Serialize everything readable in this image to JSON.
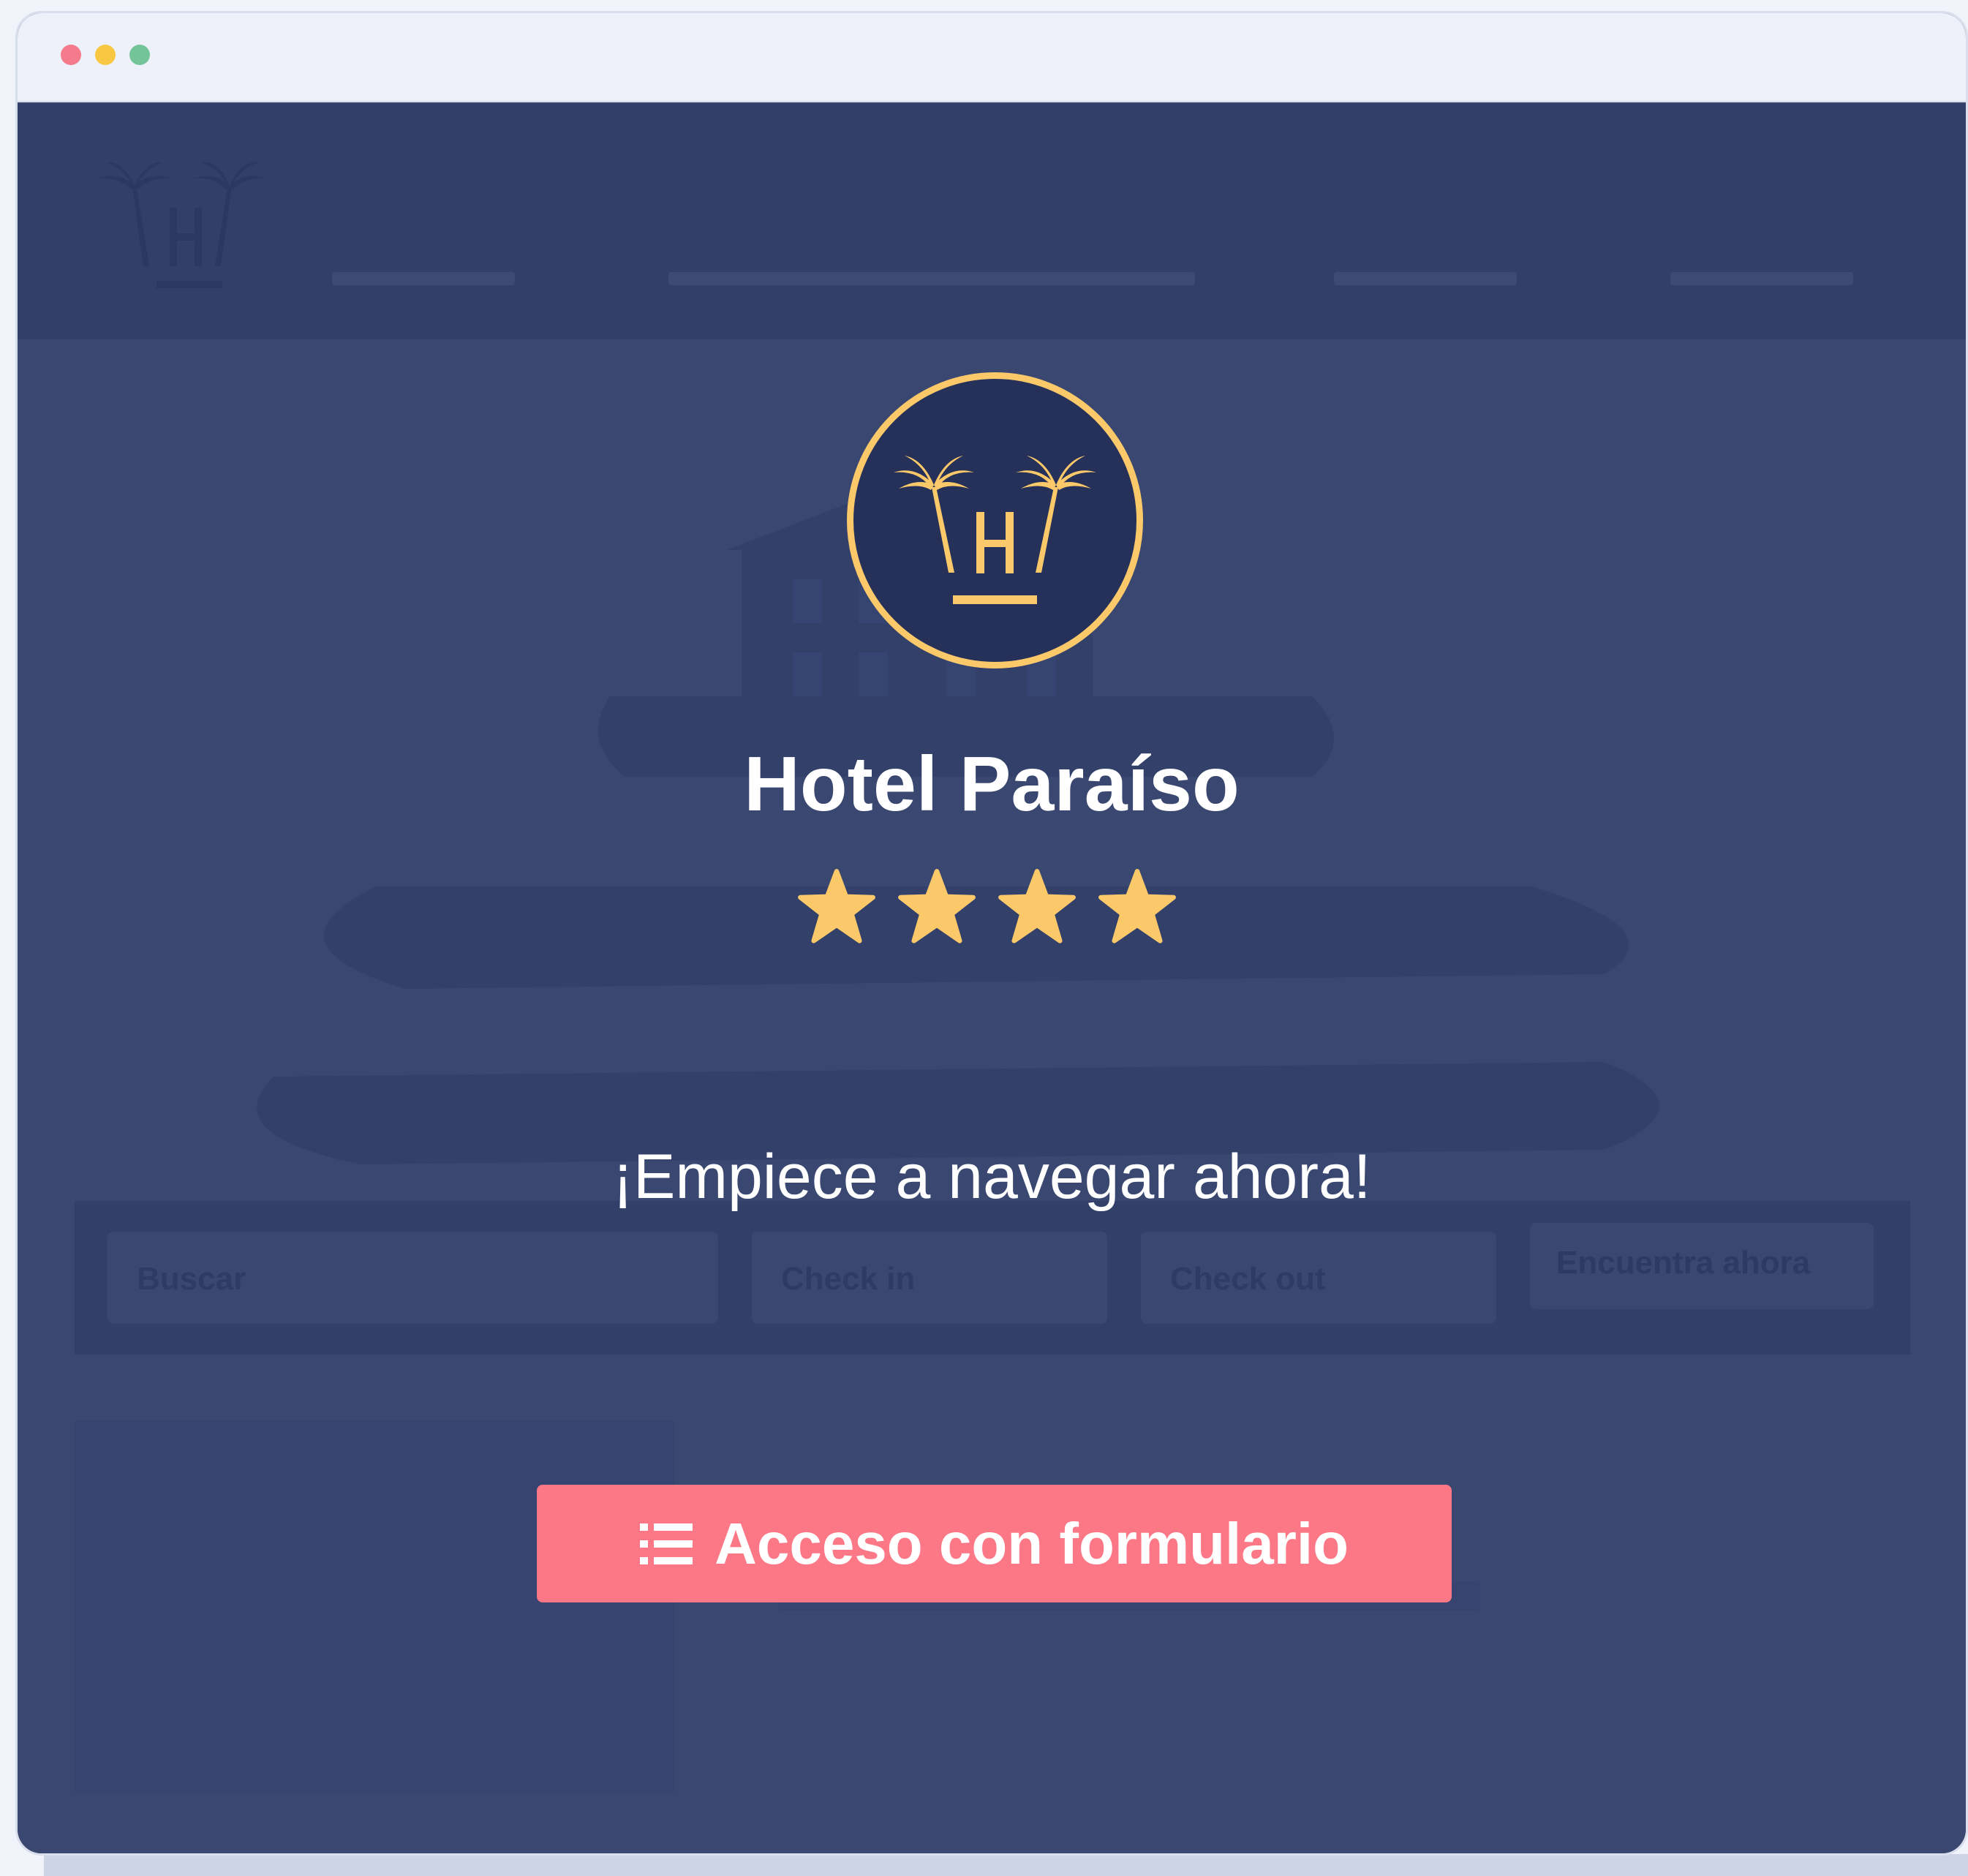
{
  "window": {
    "controls": [
      "close",
      "minimize",
      "maximize"
    ]
  },
  "background_site": {
    "search_placeholder": "Buscar",
    "checkin_placeholder": "Check in",
    "checkout_placeholder": "Check out",
    "search_button": "Encuentra ahora"
  },
  "overlay": {
    "logo_letter": "H",
    "hotel_name": "Hotel Paraíso",
    "rating_stars": 4,
    "tagline": "¡Empiece a navegar ahora!",
    "cta_label": "Acceso con formulario",
    "cta_icon": "list-icon"
  },
  "colors": {
    "overlay_bg": "#3a4770",
    "accent_gold": "#fbc96a",
    "cta_pink": "#fd7887",
    "text_white": "#ffffff"
  }
}
